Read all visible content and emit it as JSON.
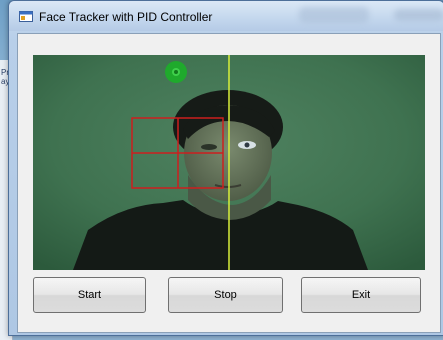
{
  "window": {
    "title": "Face Tracker with PID Controller"
  },
  "buttons": {
    "start": "Start",
    "stop": "Stop",
    "exit": "Exit"
  },
  "background_snippet": "Pr\nay",
  "colors": {
    "face_box": "#cc1f1f",
    "center_line": "#d8f03a",
    "target_marker": "#22bb33"
  }
}
